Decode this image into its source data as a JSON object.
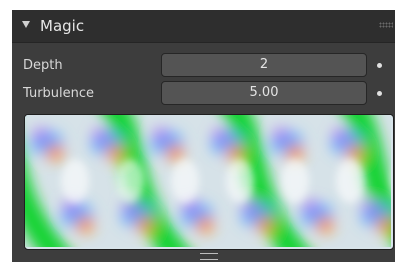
{
  "panel": {
    "title": "Magic",
    "collapse_icon": "triangle-down-icon",
    "grip_icon": "drag-grip-icon"
  },
  "fields": [
    {
      "label": "Depth",
      "value": "2"
    },
    {
      "label": "Turbulence",
      "value": "5.00"
    }
  ],
  "preview": {
    "type": "magic-texture-preview",
    "colors": [
      "#00d21e",
      "#ffffff",
      "#4aa0ff",
      "#ff8a1a",
      "#b06cf0"
    ]
  },
  "resize_icon": "resize-handle-icon"
}
